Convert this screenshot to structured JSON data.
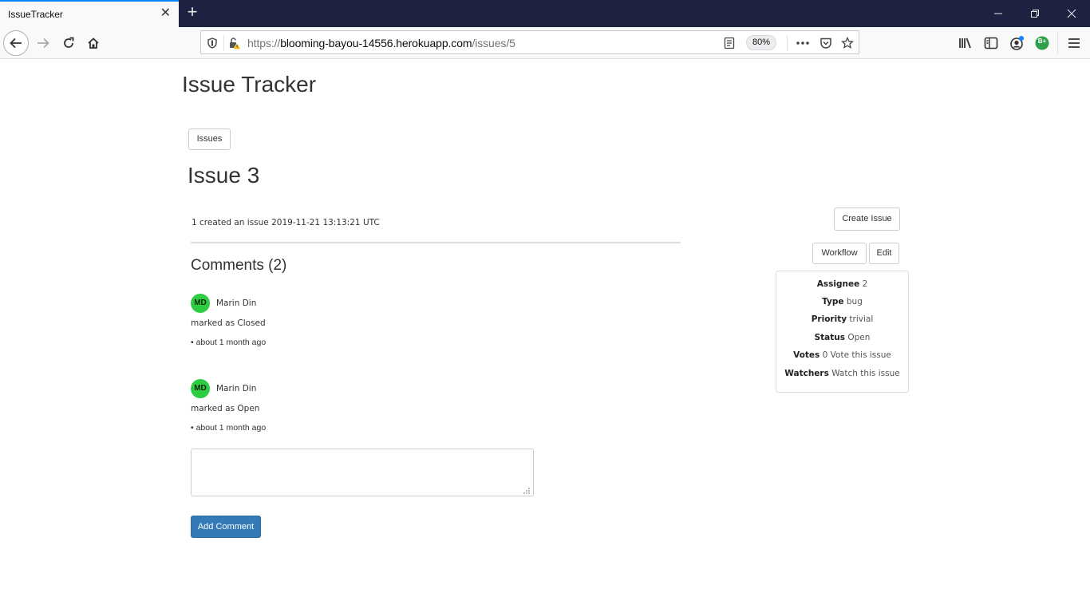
{
  "browser": {
    "tab_title": "IssueTracker",
    "tab_close_icon": "close-icon",
    "new_tab_icon": "plus-icon",
    "url_scheme": "https://",
    "url_host": "blooming-bayou-14556.herokuapp.com",
    "url_path": "/issues/5",
    "zoom_level": "80%",
    "accent_color": "#0a84ff",
    "titlebar_color": "#1f2140",
    "window_controls": [
      "minimize-icon",
      "restore-icon",
      "close-icon"
    ],
    "toolbar_icons": [
      "library-icon",
      "sidebar-icon",
      "account-icon",
      "extension-badge-icon",
      "menu-icon"
    ],
    "extension_badge_text": "B+"
  },
  "page": {
    "app_title": "Issue Tracker",
    "issues_button": "Issues",
    "issue_title": "Issue 3",
    "created_line": "1 created an issue 2019-11-21 13:13:21 UTC",
    "comments_heading": "Comments (2)",
    "comments": [
      {
        "avatar_initials": "MD",
        "author": "Marin Din",
        "body": "marked as Closed",
        "time": "• about 1 month ago"
      },
      {
        "avatar_initials": "MD",
        "author": "Marin Din",
        "body": "marked as Open",
        "time": "• about 1 month ago"
      }
    ],
    "comment_input": {
      "value": "",
      "placeholder": ""
    },
    "add_comment_button": "Add Comment",
    "primary_color": "#337ab7",
    "avatar_color": "#2ecc40"
  },
  "sidebar": {
    "create_issue_button": "Create Issue",
    "workflow_button": "Workflow",
    "edit_button": "Edit",
    "details": {
      "assignee_label": "Assignee",
      "assignee_value": "2",
      "type_label": "Type",
      "type_value": "bug",
      "priority_label": "Priority",
      "priority_value": "trivial",
      "status_label": "Status",
      "status_value": "Open",
      "votes_label": "Votes",
      "votes_value": "0",
      "vote_link": "Vote this issue",
      "watchers_label": "Watchers",
      "watch_link": "Watch this issue"
    }
  }
}
